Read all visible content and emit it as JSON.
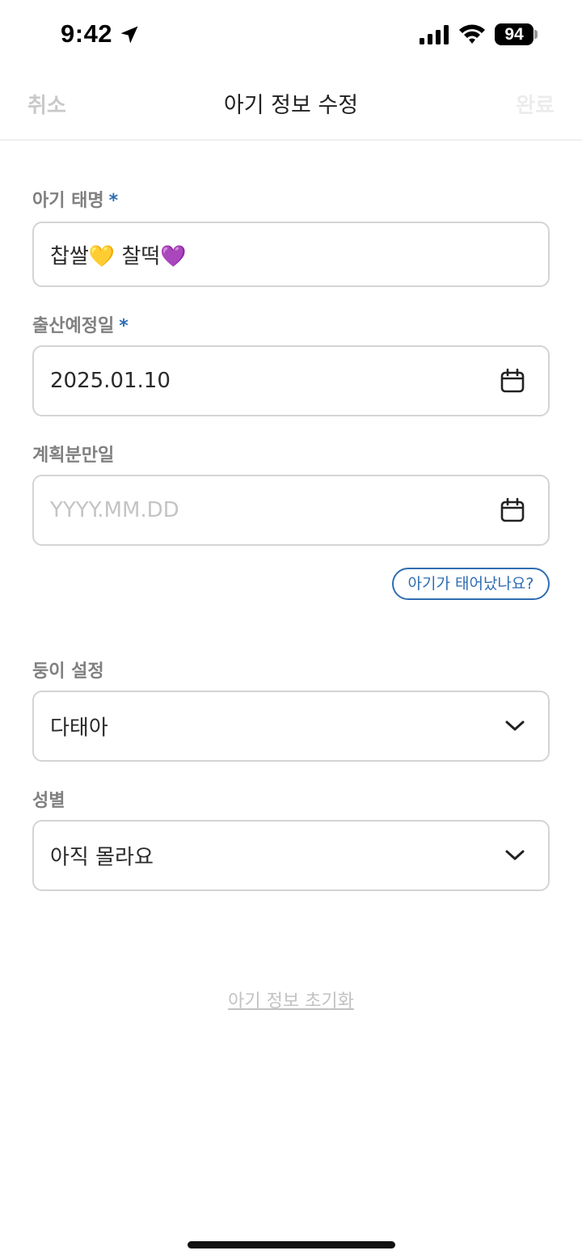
{
  "status_bar": {
    "time": "9:42",
    "battery": "94"
  },
  "nav": {
    "cancel_label": "취소",
    "title": "아기 정보 수정",
    "done_label": "완료"
  },
  "form": {
    "baby_name": {
      "label": "아기 태명",
      "required_mark": "*",
      "value": "찹쌀💛 찰떡💜"
    },
    "due_date": {
      "label": "출산예정일",
      "required_mark": "*",
      "value": "2025.01.10",
      "icon": "calendar-icon"
    },
    "planned_delivery": {
      "label": "계획분만일",
      "placeholder": "YYYY.MM.DD",
      "icon": "calendar-icon"
    },
    "born_button_label": "아기가 태어났나요?",
    "twin_setting": {
      "label": "둥이 설정",
      "selected": "다태아",
      "icon": "chevron-down-icon"
    },
    "gender": {
      "label": "성별",
      "selected": "아직 몰라요",
      "icon": "chevron-down-icon"
    }
  },
  "reset_label": "아기 정보 초기화",
  "colors": {
    "accent": "#2f6db3",
    "border": "#d4d4d4",
    "label": "#808080",
    "placeholder": "#c4c4c4"
  }
}
